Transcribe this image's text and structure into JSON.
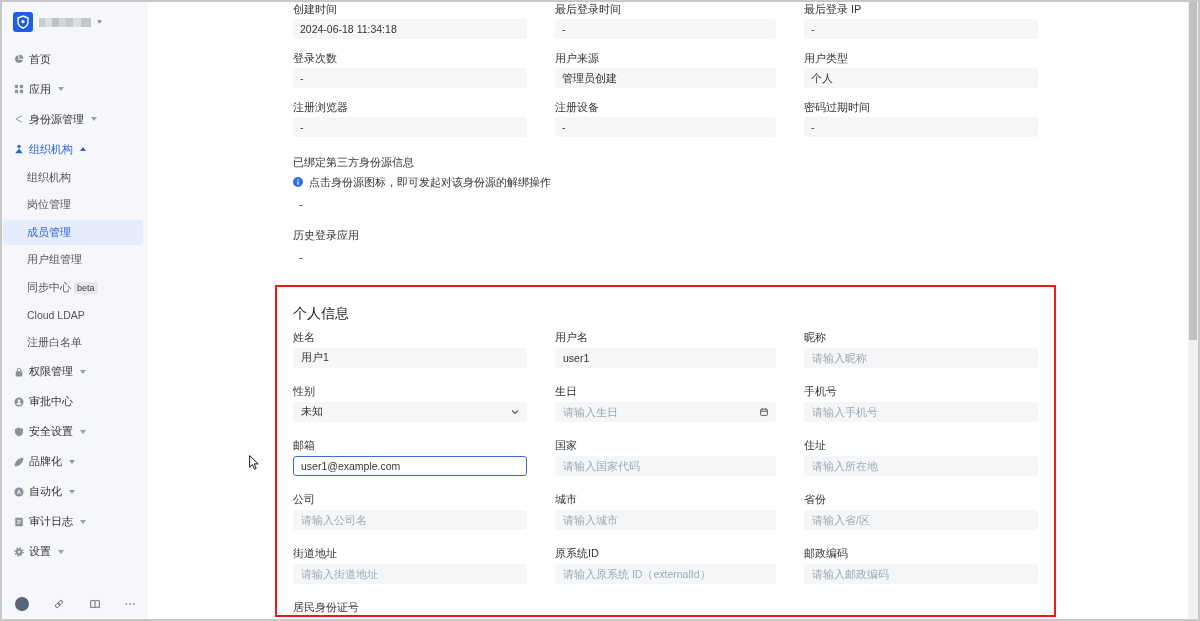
{
  "sidebar": {
    "items": [
      {
        "label": "首页",
        "kind": "link",
        "selected": false
      },
      {
        "label": "应用",
        "kind": "group",
        "expanded": false,
        "selected": false
      },
      {
        "label": "身份源管理",
        "kind": "group",
        "expanded": false,
        "selected": false
      },
      {
        "label": "组织机构",
        "kind": "group",
        "expanded": true,
        "selected": true,
        "children": [
          {
            "label": "组织机构",
            "selected": false
          },
          {
            "label": "岗位管理",
            "selected": false
          },
          {
            "label": "成员管理",
            "selected": true
          },
          {
            "label": "用户组管理",
            "selected": false
          },
          {
            "label": "同步中心",
            "badge": "beta",
            "selected": false
          },
          {
            "label": "Cloud LDAP",
            "selected": false
          },
          {
            "label": "注册白名单",
            "selected": false
          }
        ]
      },
      {
        "label": "权限管理",
        "kind": "group",
        "expanded": false,
        "selected": false
      },
      {
        "label": "审批中心",
        "kind": "link",
        "selected": false
      },
      {
        "label": "安全设置",
        "kind": "group",
        "expanded": false,
        "selected": false
      },
      {
        "label": "品牌化",
        "kind": "group",
        "expanded": false,
        "selected": false
      },
      {
        "label": "自动化",
        "kind": "group",
        "expanded": false,
        "selected": false
      },
      {
        "label": "审计日志",
        "kind": "group",
        "expanded": false,
        "selected": false
      },
      {
        "label": "设置",
        "kind": "group",
        "expanded": false,
        "selected": false
      }
    ]
  },
  "account_info": {
    "fields": [
      {
        "label": "创建时间",
        "value": "2024-06-18 11:34:18"
      },
      {
        "label": "最后登录时间",
        "value": "-"
      },
      {
        "label": "最后登录 IP",
        "value": "-"
      },
      {
        "label": "登录次数",
        "value": "-"
      },
      {
        "label": "用户来源",
        "value": "管理员创建"
      },
      {
        "label": "用户类型",
        "value": "个人"
      },
      {
        "label": "注册浏览器",
        "value": "-"
      },
      {
        "label": "注册设备",
        "value": "-"
      },
      {
        "label": "密码过期时间",
        "value": "-"
      }
    ],
    "bound_identity_sources": {
      "label": "已绑定第三方身份源信息",
      "notice": "点击身份源图标，即可发起对该身份源的解绑操作",
      "value": "-"
    },
    "login_history": {
      "label": "历史登录应用",
      "value": "-"
    }
  },
  "personal_info": {
    "title": "个人信息",
    "fields": [
      {
        "label": "姓名",
        "kind": "text",
        "value": "用户1",
        "focused": false
      },
      {
        "label": "用户名",
        "kind": "text",
        "value": "user1",
        "focused": false
      },
      {
        "label": "昵称",
        "kind": "text",
        "placeholder": "请输入昵称",
        "focused": false
      },
      {
        "label": "性别",
        "kind": "select",
        "value": "未知",
        "focused": false
      },
      {
        "label": "生日",
        "kind": "date",
        "placeholder": "请输入生日",
        "focused": false
      },
      {
        "label": "手机号",
        "kind": "text",
        "placeholder": "请输入手机号",
        "focused": false
      },
      {
        "label": "邮箱",
        "kind": "text",
        "value": "user1@example.com",
        "focused": true
      },
      {
        "label": "国家",
        "kind": "text",
        "placeholder": "请输入国家代码",
        "focused": false
      },
      {
        "label": "住址",
        "kind": "text",
        "placeholder": "请输入所在地",
        "focused": false
      },
      {
        "label": "公司",
        "kind": "text",
        "placeholder": "请输入公司名",
        "focused": false
      },
      {
        "label": "城市",
        "kind": "text",
        "placeholder": "请输入城市",
        "focused": false
      },
      {
        "label": "省份",
        "kind": "text",
        "placeholder": "请输入省/区",
        "focused": false
      },
      {
        "label": "街道地址",
        "kind": "text",
        "placeholder": "请输入街道地址",
        "focused": false
      },
      {
        "label": "原系统ID",
        "kind": "text",
        "placeholder": "请输入原系统 ID（externalId）",
        "focused": false
      },
      {
        "label": "邮政编码",
        "kind": "text",
        "placeholder": "请输入邮政编码",
        "focused": false
      }
    ],
    "next_label": "居民身份证号"
  }
}
